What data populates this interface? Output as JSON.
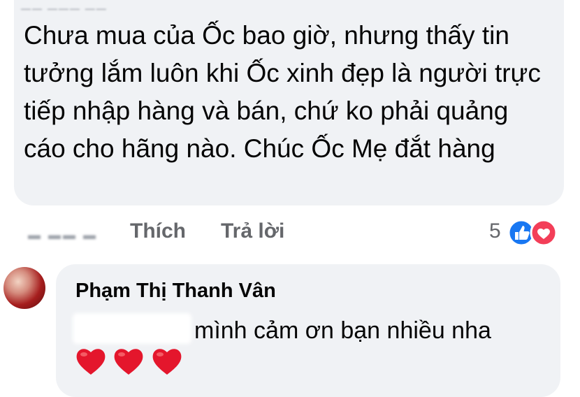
{
  "comment": {
    "text": "Chưa mua của Ốc bao giờ, nhưng thấy tin tưởng lắm luôn khi Ốc xinh đẹp là người trực tiếp nhập hàng và bán, chứ ko phải quảng cáo cho hãng nào. Chúc Ốc Mẹ đắt hàng",
    "actions": {
      "like_label": "Thích",
      "reply_label": "Trả lời",
      "reaction_count": "5",
      "reaction_icons": [
        "thumbs-up-icon",
        "heart-icon"
      ]
    }
  },
  "reply": {
    "author": "Phạm Thị Thanh Vân",
    "text": "mình cảm ơn bạn nhiều nha",
    "emoji": [
      "heart-icon",
      "heart-icon",
      "heart-icon"
    ]
  },
  "colors": {
    "bubble_bg": "#f0f2f5",
    "action_text": "#65676b",
    "like_blue": "#1877f2",
    "love_red": "#f33e58",
    "emoji_heart": "#e4162c"
  }
}
